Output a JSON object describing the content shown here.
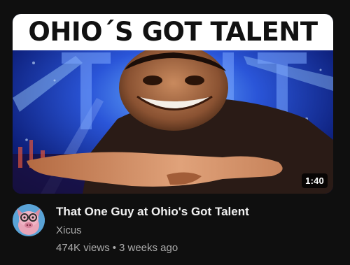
{
  "video": {
    "thumbnail_headline": "OHIO´S GOT TALENT",
    "thumbnail_icon": "meme-face-pointing-image",
    "duration": "1:40",
    "title": "That One Guy at Ohio's Got Talent",
    "channel": "Xicus",
    "views": "474K views",
    "separator": "•",
    "age": "3 weeks ago",
    "avatar_icon": "pig-with-glasses-avatar"
  },
  "colors": {
    "background": "#0f0f0f",
    "title_text": "#f1f1f1",
    "secondary_text": "#aaaaaa",
    "banner_white": "#ffffff",
    "stage_blue": "#1d3fb0"
  }
}
